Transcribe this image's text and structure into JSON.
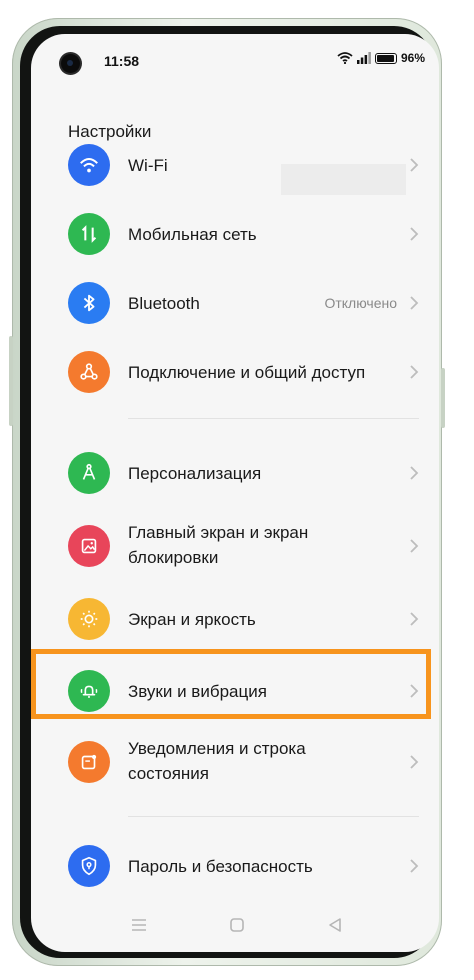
{
  "status_bar": {
    "time": "11:58",
    "battery": "96%",
    "battery_level": 0.96
  },
  "page_title": "Настройки",
  "items": [
    {
      "id": "wifi",
      "label": "Wi-Fi",
      "value": "",
      "icon": "wifi-icon",
      "color": "#2d6cf0"
    },
    {
      "id": "mobile",
      "label": "Мобильная сеть",
      "value": "",
      "icon": "mobile-data-icon",
      "color": "#2eb852"
    },
    {
      "id": "bluetooth",
      "label": "Bluetooth",
      "value": "Отключено",
      "icon": "bluetooth-icon",
      "color": "#2a7cf2"
    },
    {
      "id": "connection",
      "label": "Подключение и общий доступ",
      "value": "",
      "icon": "share-icon",
      "color": "#f47a2e"
    },
    {
      "id": "personalization",
      "label": "Персонализация",
      "value": "",
      "icon": "compass-icon",
      "color": "#2eb852"
    },
    {
      "id": "home_lock",
      "label_line1": "Главный экран и экран",
      "label_line2": "блокировки",
      "value": "",
      "icon": "image-icon",
      "color": "#e8455a"
    },
    {
      "id": "display",
      "label": "Экран и яркость",
      "value": "",
      "icon": "sun-icon",
      "color": "#f7b733"
    },
    {
      "id": "sound",
      "label": "Звуки и вибрация",
      "value": "",
      "icon": "bell-icon",
      "color": "#2eb852"
    },
    {
      "id": "notifications",
      "label_line1": "Уведомления и строка",
      "label_line2": "состояния",
      "value": "",
      "icon": "notification-icon",
      "color": "#f47a2e"
    },
    {
      "id": "security",
      "label": "Пароль и безопасность",
      "value": "",
      "icon": "shield-icon",
      "color": "#2d6cf0"
    }
  ],
  "highlight_color": "#f7941d",
  "nav_bar": {
    "icons": [
      "menu-icon",
      "home-icon",
      "back-icon"
    ]
  }
}
